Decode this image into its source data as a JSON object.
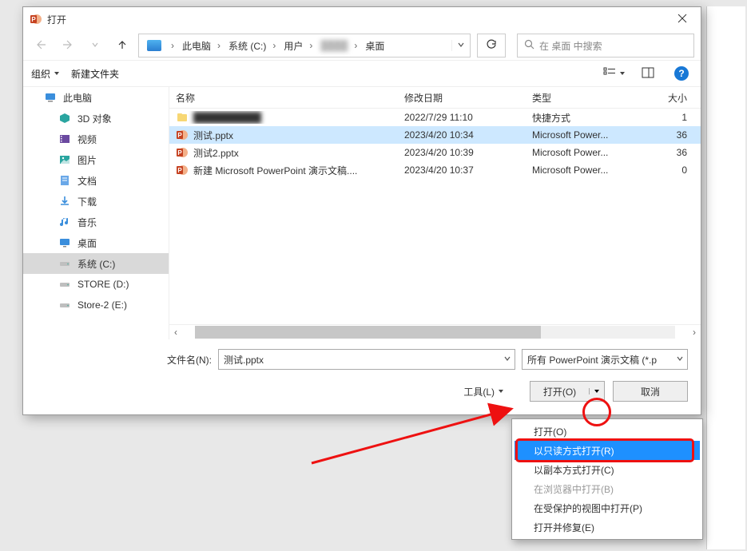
{
  "title": "打开",
  "close_tooltip": "关闭",
  "nav": {
    "back": "后退",
    "forward": "前进",
    "up": "上一级"
  },
  "path": {
    "root": "此电脑",
    "drive": "系统 (C:)",
    "seg3": "用户",
    "seg4_redacted": "████",
    "seg5": "桌面"
  },
  "search_placeholder": "在 桌面 中搜索",
  "toolbar": {
    "organize": "组织",
    "new_folder": "新建文件夹",
    "view_tooltip": "更改视图",
    "preview_tooltip": "预览窗格",
    "help": "?"
  },
  "sidebar": {
    "items": [
      {
        "label": "此电脑",
        "icon": "pc"
      },
      {
        "label": "3D 对象",
        "icon": "3d"
      },
      {
        "label": "视频",
        "icon": "video"
      },
      {
        "label": "图片",
        "icon": "picture"
      },
      {
        "label": "文档",
        "icon": "doc"
      },
      {
        "label": "下载",
        "icon": "download"
      },
      {
        "label": "音乐",
        "icon": "music"
      },
      {
        "label": "桌面",
        "icon": "desktop"
      },
      {
        "label": "系统 (C:)",
        "icon": "drive"
      },
      {
        "label": "STORE (D:)",
        "icon": "drive"
      },
      {
        "label": "Store-2 (E:)",
        "icon": "drive"
      }
    ],
    "selected_index": 8
  },
  "columns": {
    "name": "名称",
    "date": "修改日期",
    "type": "类型",
    "size": "大小"
  },
  "files": [
    {
      "name": "",
      "date": "2022/7/29 11:10",
      "type": "快捷方式",
      "size": "1",
      "selected": false,
      "icon": "shortcut",
      "redacted": true
    },
    {
      "name": "测试.pptx",
      "date": "2023/4/20 10:34",
      "type": "Microsoft Power...",
      "size": "36",
      "selected": true,
      "icon": "pptx"
    },
    {
      "name": "测试2.pptx",
      "date": "2023/4/20 10:39",
      "type": "Microsoft Power...",
      "size": "36",
      "selected": false,
      "icon": "pptx"
    },
    {
      "name": "新建 Microsoft PowerPoint 演示文稿....",
      "date": "2023/4/20 10:37",
      "type": "Microsoft Power...",
      "size": "0",
      "selected": false,
      "icon": "pptx"
    }
  ],
  "footer": {
    "filename_label": "文件名(N):",
    "filename_value": "测试.pptx",
    "filter_value": "所有 PowerPoint 演示文稿 (*.p",
    "tools": "工具(L)",
    "open": "打开(O)",
    "cancel": "取消"
  },
  "dropdown": {
    "items": [
      {
        "label": "打开(O)",
        "disabled": false,
        "selected": false
      },
      {
        "label": "以只读方式打开(R)",
        "disabled": false,
        "selected": true
      },
      {
        "label": "以副本方式打开(C)",
        "disabled": false,
        "selected": false
      },
      {
        "label": "在浏览器中打开(B)",
        "disabled": true,
        "selected": false
      },
      {
        "label": "在受保护的视图中打开(P)",
        "disabled": false,
        "selected": false
      },
      {
        "label": "打开并修复(E)",
        "disabled": false,
        "selected": false
      }
    ]
  }
}
